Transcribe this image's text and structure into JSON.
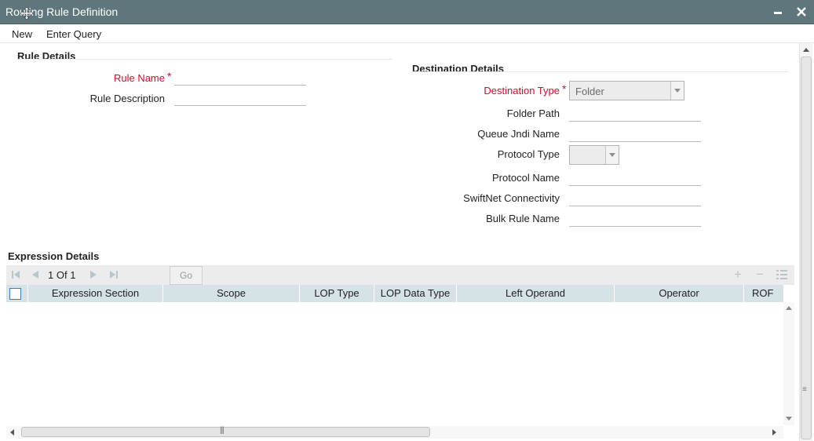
{
  "window": {
    "title": "Routing Rule Definition"
  },
  "menu": {
    "new": "New",
    "enter_query": "Enter Query"
  },
  "rule_details": {
    "heading": "Rule Details",
    "rule_name_label": "Rule Name",
    "rule_name_value": "",
    "rule_description_label": "Rule Description",
    "rule_description_value": ""
  },
  "destination_details": {
    "heading": "Destination Details",
    "destination_type_label": "Destination Type",
    "destination_type_value": "Folder",
    "folder_path_label": "Folder Path",
    "queue_jndi_name_label": "Queue Jndi Name",
    "protocol_type_label": "Protocol Type",
    "protocol_type_value": "",
    "protocol_name_label": "Protocol Name",
    "swiftnet_connectivity_label": "SwiftNet Connectivity",
    "bulk_rule_name_label": "Bulk Rule Name"
  },
  "required_marker": "*",
  "expression_details": {
    "heading": "Expression Details",
    "pager": {
      "current": "1",
      "of_label": "Of",
      "total": "1",
      "go_label": "Go"
    },
    "columns": [
      "Expression Section",
      "Scope",
      "LOP Type",
      "LOP Data Type",
      "Left Operand",
      "Operator",
      "ROF"
    ],
    "rows": []
  },
  "colors": {
    "titlebar": "#5f777c",
    "required": "#c8102e",
    "grid_header": "#d5e2e6"
  }
}
